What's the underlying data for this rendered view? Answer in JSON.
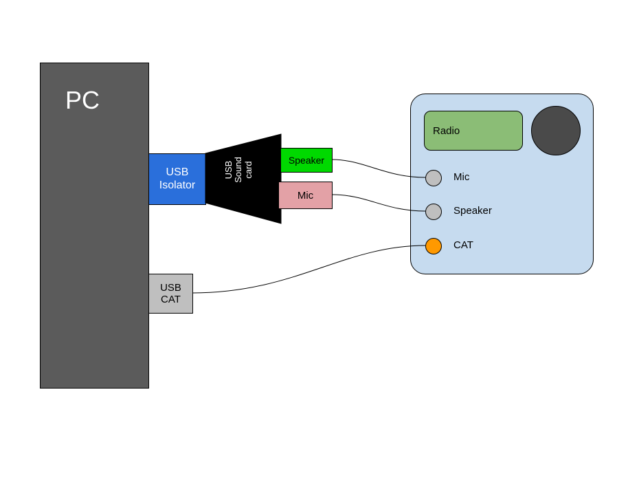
{
  "pc": {
    "label": "PC"
  },
  "usb_isolator": {
    "label": "USB\nIsolator"
  },
  "usb_cat": {
    "label": "USB\nCAT"
  },
  "sound_card": {
    "label": "USB\nSound\ncard",
    "speaker_label": "Speaker",
    "mic_label": "Mic"
  },
  "radio": {
    "screen_label": "Radio",
    "ports": {
      "mic": "Mic",
      "speaker": "Speaker",
      "cat": "CAT"
    }
  },
  "colors": {
    "pc": "#5b5b5b",
    "usb_isolator": "#2a6fdb",
    "usb_cat": "#bfbfbf",
    "sound_card": "#000000",
    "speaker_block": "#00d900",
    "mic_block": "#e3a1a6",
    "radio_panel": "#c6dbef",
    "radio_screen": "#8bbd76",
    "knob": "#4a4a4a",
    "port_grey": "#bfbfbf",
    "port_orange": "#ff9900"
  },
  "connections": [
    {
      "from": "sound_card.speaker",
      "to": "radio.mic"
    },
    {
      "from": "sound_card.mic",
      "to": "radio.speaker"
    },
    {
      "from": "usb_cat",
      "to": "radio.cat"
    }
  ]
}
